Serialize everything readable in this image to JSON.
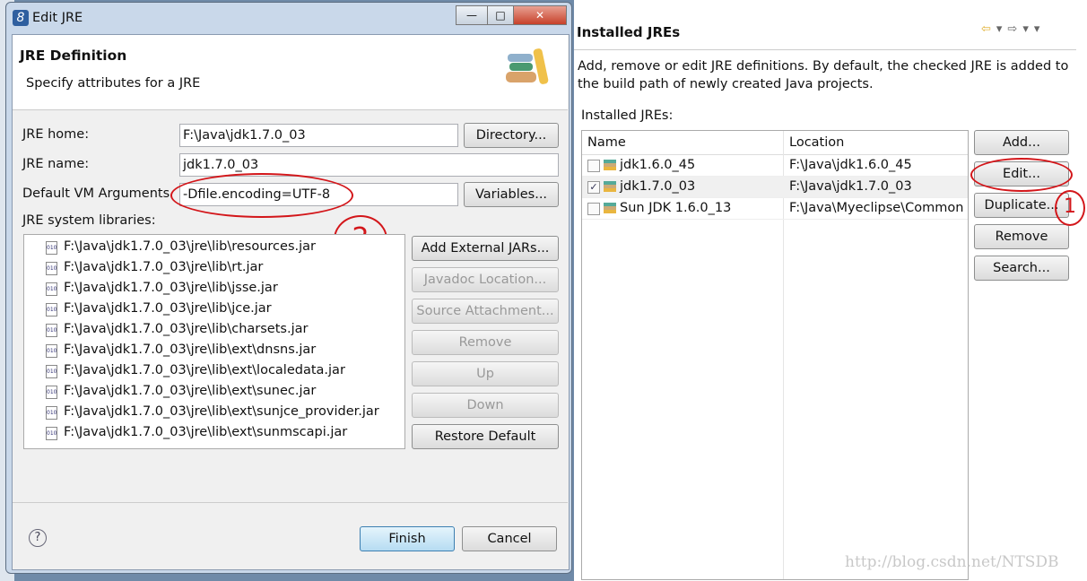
{
  "preferences": {
    "title": "Installed JREs",
    "description": "Add, remove or edit JRE definitions. By default, the checked JRE is added to the build path of newly created Java projects.",
    "table_label": "Installed JREs:",
    "columns": [
      "Name",
      "Location"
    ],
    "rows": [
      {
        "name": "jdk1.6.0_45",
        "location": "F:\\Java\\jdk1.6.0_45",
        "checked": false
      },
      {
        "name": "jdk1.7.0_03",
        "location": "F:\\Java\\jdk1.7.0_03",
        "checked": true
      },
      {
        "name": "Sun JDK 1.6.0_13",
        "location": "F:\\Java\\Myeclipse\\Common",
        "checked": false
      }
    ],
    "buttons": {
      "add": "Add...",
      "edit": "Edit...",
      "duplicate": "Duplicate...",
      "remove": "Remove",
      "search": "Search..."
    }
  },
  "dialog": {
    "title": "Edit JRE",
    "header_title": "JRE Definition",
    "header_subtitle": "Specify attributes for a JRE",
    "jre_home_label": "JRE home:",
    "jre_home": "F:\\Java\\jdk1.7.0_03",
    "jre_name_label": "JRE name:",
    "jre_name": "jdk1.7.0_03",
    "vm_args_label": "Default VM Arguments",
    "vm_args": "-Dfile.encoding=UTF-8",
    "libs_label": "JRE system libraries:",
    "directory": "Directory...",
    "variables": "Variables...",
    "libraries": [
      "F:\\Java\\jdk1.7.0_03\\jre\\lib\\resources.jar",
      "F:\\Java\\jdk1.7.0_03\\jre\\lib\\rt.jar",
      "F:\\Java\\jdk1.7.0_03\\jre\\lib\\jsse.jar",
      "F:\\Java\\jdk1.7.0_03\\jre\\lib\\jce.jar",
      "F:\\Java\\jdk1.7.0_03\\jre\\lib\\charsets.jar",
      "F:\\Java\\jdk1.7.0_03\\jre\\lib\\ext\\dnsns.jar",
      "F:\\Java\\jdk1.7.0_03\\jre\\lib\\ext\\localedata.jar",
      "F:\\Java\\jdk1.7.0_03\\jre\\lib\\ext\\sunec.jar",
      "F:\\Java\\jdk1.7.0_03\\jre\\lib\\ext\\sunjce_provider.jar",
      "F:\\Java\\jdk1.7.0_03\\jre\\lib\\ext\\sunmscapi.jar"
    ],
    "lib_buttons": {
      "add_external": "Add External JARs...",
      "javadoc": "Javadoc Location...",
      "source": "Source Attachment...",
      "remove": "Remove",
      "up": "Up",
      "down": "Down",
      "restore": "Restore Default"
    },
    "finish": "Finish",
    "cancel": "Cancel"
  },
  "annotations": {
    "one": "1",
    "two": "2"
  },
  "watermark": "http://blog.csdn.net/NTSDB",
  "colors": {
    "annotation": "#d3161a",
    "dialog_frame": "#c9d8ea"
  }
}
